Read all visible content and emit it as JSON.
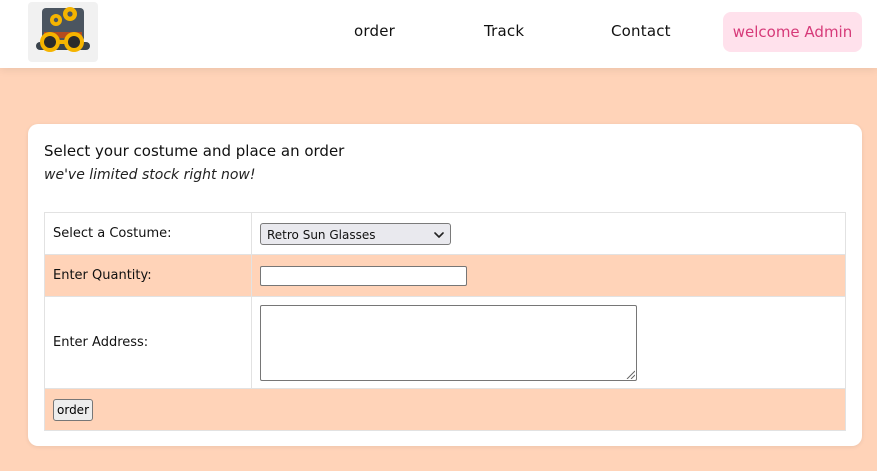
{
  "header": {
    "logo_icon": "steampunk-top-hat-goggles-icon",
    "nav": {
      "order": "order",
      "track": "Track",
      "contact": "Contact"
    },
    "welcome_label": "welcome Admin",
    "colors": {
      "welcome_bg": "#ffe1ec",
      "welcome_text": "#d63a79"
    }
  },
  "page": {
    "background": "#ffd3b8"
  },
  "form": {
    "title": "Select your costume and place an order",
    "subtitle": "we've limited stock right now!",
    "fields": {
      "costume_label": "Select a Costume:",
      "costume_selected": "Retro Sun Glasses",
      "quantity_label": "Enter Quantity:",
      "quantity_value": "",
      "address_label": "Enter Address:",
      "address_value": ""
    },
    "submit_label": "order"
  }
}
